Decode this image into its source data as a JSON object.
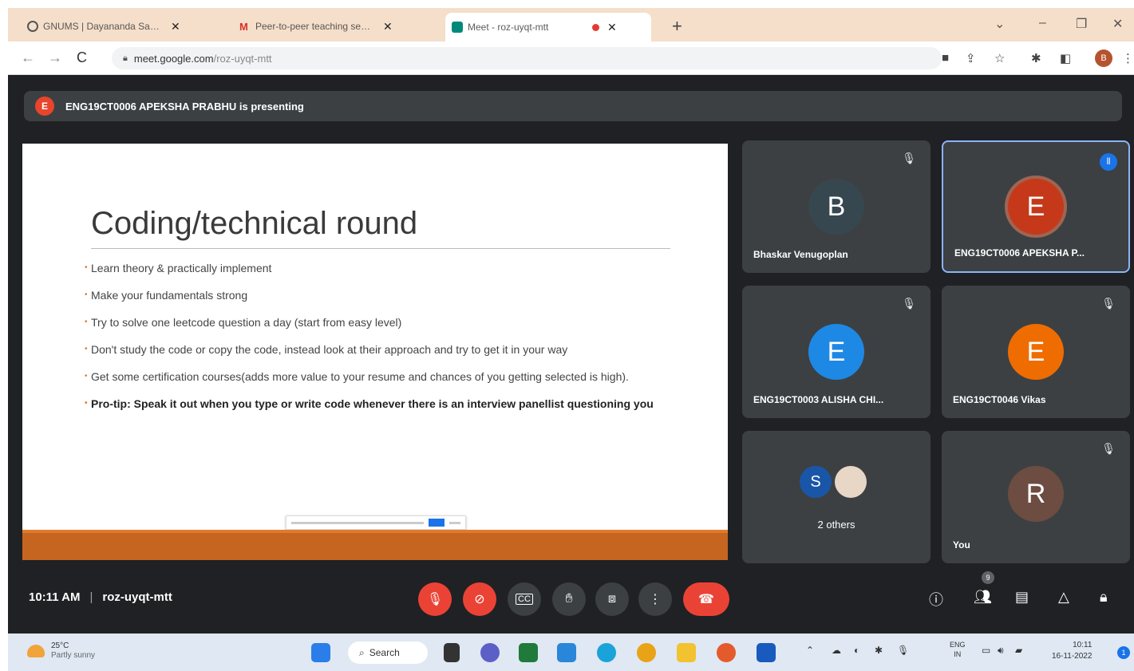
{
  "browser": {
    "tabs": [
      {
        "title": "GNUMS | Dayananda Sagar Insti"
      },
      {
        "title": "Peer-to-peer teaching sessions"
      },
      {
        "title": "Meet - roz-uyqt-mtt"
      }
    ],
    "new_tab": "+",
    "url_host": "meet.google.com",
    "url_path": "/roz-uyqt-mtt",
    "profile_initial": "B"
  },
  "meet": {
    "presenter_initial": "E",
    "presenting_text": "ENG19CT0006 APEKSHA PRABHU is presenting",
    "slide": {
      "title": "Coding/technical round",
      "bullets": [
        "Learn theory & practically implement",
        "Make your fundamentals strong",
        "Try to solve one leetcode question a day (start from easy level)",
        "Don't study the code or copy the code, instead look at their approach and try to get it in your way",
        "Get some certification courses(adds more value to your resume and chances of you getting selected is high).",
        "Pro-tip: Speak it out when you type or write code whenever there is an interview panellist questioning you"
      ]
    },
    "participants": [
      {
        "initial": "B",
        "name": "Bhaskar Venugoplan",
        "color": "#37474f"
      },
      {
        "initial": "E",
        "name": "ENG19CT0006 APEKSHA P...",
        "color": "#c5391a"
      },
      {
        "initial": "E",
        "name": "ENG19CT0003 ALISHA CHI...",
        "color": "#1e88e5"
      },
      {
        "initial": "E",
        "name": "ENG19CT0046 Vikas",
        "color": "#ef6c00"
      },
      {
        "initial": "R",
        "name": "You",
        "color": "#6d4c41"
      }
    ],
    "others": {
      "initial": "S",
      "label": "2 others"
    },
    "time": "10:11 AM",
    "meeting_code": "roz-uyqt-mtt",
    "participant_badge": "9"
  },
  "taskbar": {
    "temp": "25°C",
    "weather": "Partly sunny",
    "search_label": "Search",
    "lang_top": "ENG",
    "lang_bottom": "IN",
    "clock_time": "10:11",
    "clock_date": "16-11-2022",
    "notif_count": "1"
  },
  "colors": {
    "meet_bg": "#202124",
    "tile_bg": "#3c4043",
    "end_call": "#ea4335",
    "slide_accent": "#c5651f"
  }
}
